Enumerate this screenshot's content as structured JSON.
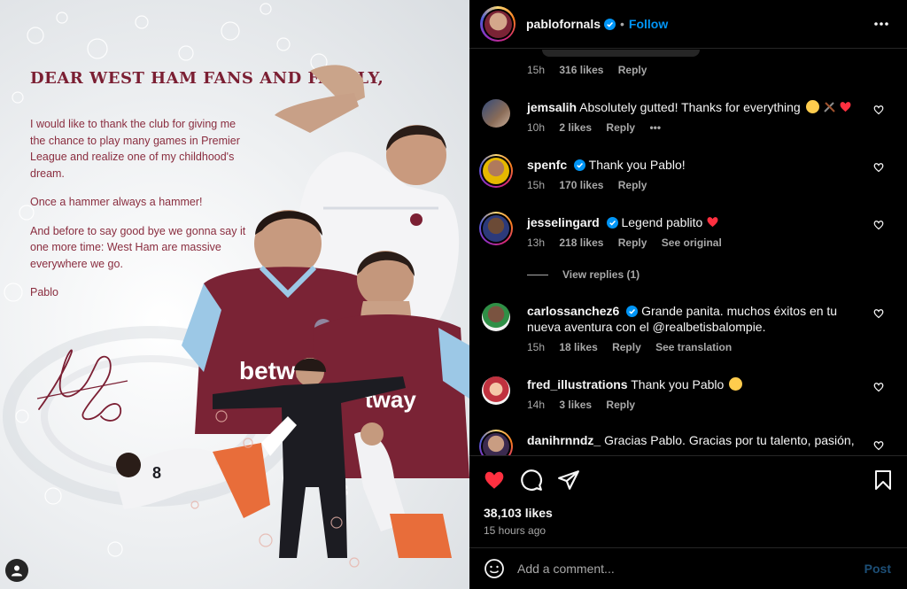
{
  "letter": {
    "title": "DEAR WEST HAM FANS AND FAMILY,",
    "paragraphs": [
      "I would like to thank the club for giving me the chance to play many games in Premier League and realize one of my childhood's dream.",
      "Once a hammer always a hammer!",
      "And before to say good bye we gonna say it one more time: West Ham are massive everywhere we go.",
      "Pablo"
    ],
    "shirt_text": "betway",
    "shirt_numbers": [
      "8",
      "8"
    ]
  },
  "header": {
    "username": "pablofornals",
    "separator": "•",
    "follow_label": "Follow"
  },
  "top_meta": {
    "time": "15h",
    "likes": "316 likes",
    "reply": "Reply"
  },
  "comments": [
    {
      "user": "jemsalih",
      "text": "Absolutely gutted! Thanks for everything",
      "emojis": [
        "crying-face",
        "hammer-and-pick",
        "red-heart"
      ],
      "time": "10h",
      "likes": "2 likes",
      "reply": "Reply",
      "extra": "•••"
    },
    {
      "user": "spenfc",
      "verified": true,
      "text": "Thank you Pablo!",
      "time": "15h",
      "likes": "170 likes",
      "reply": "Reply"
    },
    {
      "user": "jesselingard",
      "verified": true,
      "text": "Legend pablito",
      "emojis": [
        "red-heart"
      ],
      "time": "13h",
      "likes": "218 likes",
      "reply": "Reply",
      "extra": "See original"
    },
    {
      "user": "carlossanchez6",
      "verified": true,
      "text": "Grande panita. muchos éxitos en tu nueva aventura con el @realbetisbalompie.",
      "time": "15h",
      "likes": "18 likes",
      "reply": "Reply",
      "extra": "See translation"
    },
    {
      "user": "fred_illustrations",
      "text": "Thank you Pablo",
      "emojis": [
        "sad-face"
      ],
      "time": "14h",
      "likes": "3 likes",
      "reply": "Reply"
    },
    {
      "user": "danihrnndz_",
      "text": "Gracias Pablo. Gracias por tu talento, pasión,"
    }
  ],
  "view_replies": "View replies (1)",
  "post": {
    "likes": "38,103 likes",
    "time_ago": "15 hours ago",
    "comment_placeholder": "Add a comment...",
    "post_label": "Post"
  },
  "colors": {
    "accent_blue": "#0095f6",
    "like_red": "#ff3040",
    "claret": "#7b1f33",
    "sky_blue": "#9cc8e6"
  },
  "icons": [
    "more-icon",
    "verified-icon",
    "heart-icon",
    "comment-icon",
    "share-icon",
    "bookmark-icon",
    "emoji-icon",
    "user-icon"
  ]
}
